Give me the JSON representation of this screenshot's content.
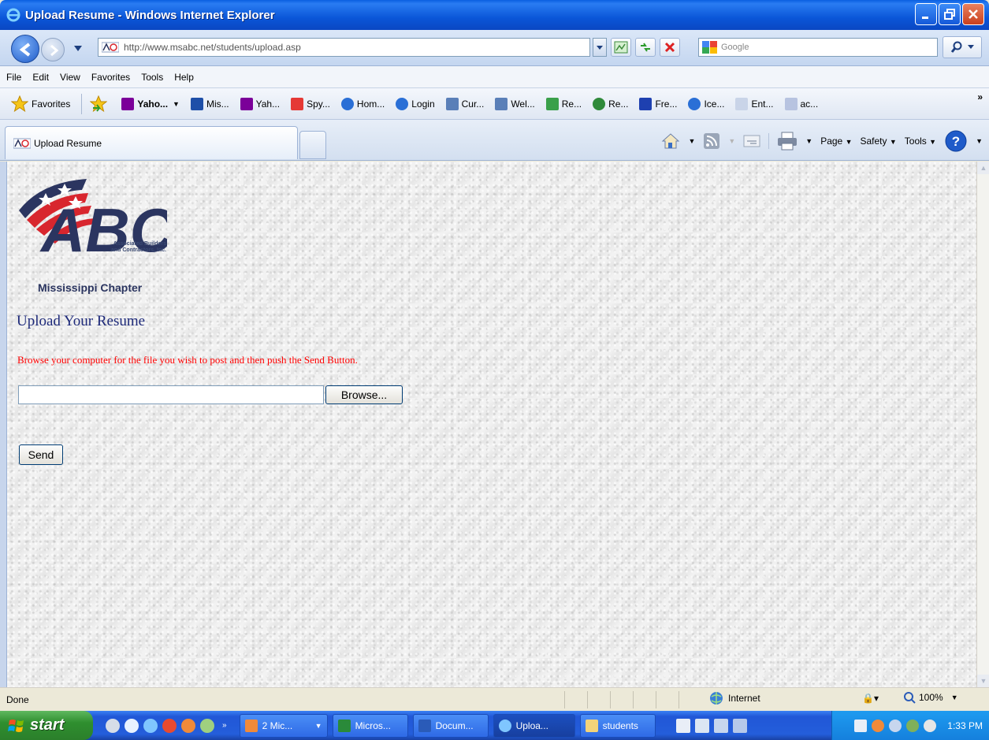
{
  "window": {
    "title": "Upload Resume - Windows Internet Explorer"
  },
  "navbar": {
    "address_url": "http://www.msabc.net/students/upload.asp",
    "search_placeholder": "Google"
  },
  "menubar": {
    "items": [
      "File",
      "Edit",
      "View",
      "Favorites",
      "Tools",
      "Help"
    ]
  },
  "favorites_bar": {
    "favorites_label": "Favorites",
    "items": [
      "Yaho...",
      "Mis...",
      "Yah...",
      "Spy...",
      "Hom...",
      "Login",
      "Cur...",
      "Wel...",
      "Re...",
      "Re...",
      "Fre...",
      "Ice...",
      "Ent...",
      "ac..."
    ],
    "more": "»"
  },
  "tabs": {
    "active_tab_label": "Upload Resume"
  },
  "command_bar": {
    "page": "Page",
    "safety": "Safety",
    "tools": "Tools"
  },
  "page": {
    "logo_caption_line1": "Associated Builders",
    "logo_caption_line2": "and Contractors, Inc.",
    "chapter": "Mississippi Chapter",
    "heading": "Upload Your Resume",
    "instructions": "Browse your computer for the file you wish to post and then push the Send Button.",
    "file_input_value": "",
    "browse_label": "Browse...",
    "send_label": "Send"
  },
  "statusbar": {
    "status_text": "Done",
    "zone": "Internet",
    "zoom": "100%"
  },
  "taskbar": {
    "start_label": "start",
    "buttons": [
      "2 Mic...",
      "Micros...",
      "Docum...",
      "Uploa...",
      "students"
    ],
    "clock": "1:33 PM"
  },
  "colors": {
    "heading": "#1e2a7a",
    "instructions": "#ff0000",
    "logo_navy": "#2b3560",
    "logo_red": "#d8262e"
  }
}
